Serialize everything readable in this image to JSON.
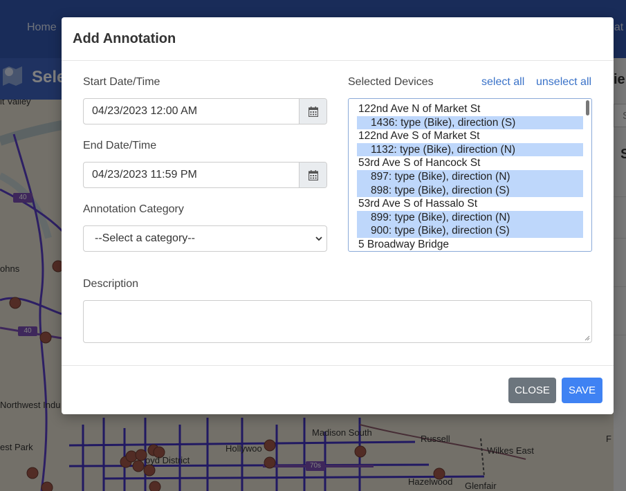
{
  "navbar": {
    "home_label": "Home",
    "right_label_fragment": "eat"
  },
  "subbar": {
    "title_fragment": "Sele"
  },
  "side_panel": {
    "heading_fragment": "ie",
    "field_fragment": "S",
    "item_fragment": "S"
  },
  "map": {
    "labels": {
      "valley": "lt Valley",
      "johns": "ohns",
      "northwest": "Northwest Indu",
      "west_park": "est Park",
      "hollywood": "Hollywoo",
      "lloyd": "oyd District",
      "madison": "Madison South",
      "russell": "Russell",
      "wilkes": "Wilkes East",
      "hazelwood": "Hazelwood",
      "glenfair": "Glenfair",
      "f": "F"
    },
    "shields": {
      "i40_a": "40",
      "i40_b": "40",
      "i70s": "70s"
    }
  },
  "modal": {
    "title": "Add Annotation",
    "start": {
      "label": "Start Date/Time",
      "value": "04/23/2023 12:00 AM"
    },
    "end": {
      "label": "End Date/Time",
      "value": "04/23/2023 11:59 PM"
    },
    "category": {
      "label": "Annotation Category",
      "selected": "--Select a category--"
    },
    "devices": {
      "label": "Selected Devices",
      "select_all": "select all",
      "unselect_all": "unselect all",
      "rows": [
        {
          "text": "122nd Ave N of Market St",
          "group": true
        },
        {
          "text": "1436: type (Bike), direction (S)",
          "group": false
        },
        {
          "text": "122nd Ave S of Market St",
          "group": true
        },
        {
          "text": "1132: type (Bike), direction (N)",
          "group": false
        },
        {
          "text": "53rd Ave S of Hancock St",
          "group": true
        },
        {
          "text": "897: type (Bike), direction (N)",
          "group": false
        },
        {
          "text": "898: type (Bike), direction (S)",
          "group": false
        },
        {
          "text": "53rd Ave S of Hassalo St",
          "group": true
        },
        {
          "text": "899: type (Bike), direction (N)",
          "group": false
        },
        {
          "text": "900: type (Bike), direction (S)",
          "group": false
        },
        {
          "text": "5 Broadway Bridge",
          "group": true
        }
      ]
    },
    "description": {
      "label": "Description",
      "value": ""
    },
    "close_label": "CLOSE",
    "save_label": "SAVE"
  },
  "colors": {
    "navbar": "#3358b3",
    "selected_option": "#bed7fb",
    "save_button": "#3f82f3",
    "close_button": "#6c757d",
    "link": "#3a72c8"
  }
}
